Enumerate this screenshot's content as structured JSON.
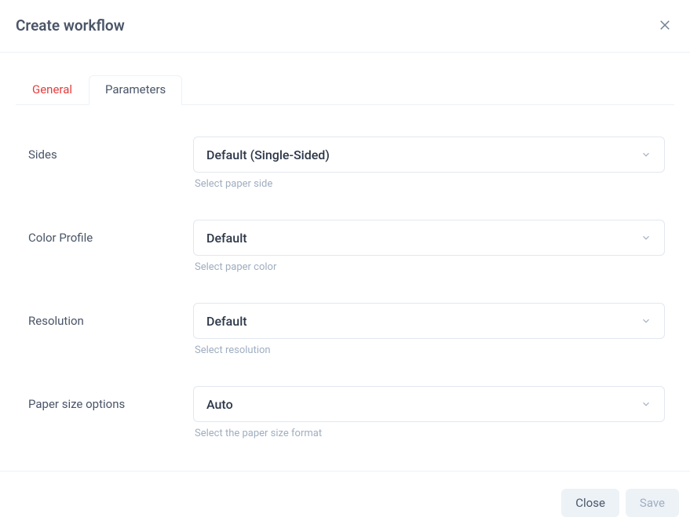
{
  "header": {
    "title": "Create workflow"
  },
  "tabs": {
    "general": "General",
    "parameters": "Parameters"
  },
  "fields": {
    "sides": {
      "label": "Sides",
      "value": "Default (Single-Sided)",
      "helper": "Select paper side"
    },
    "color_profile": {
      "label": "Color Profile",
      "value": "Default",
      "helper": "Select paper color"
    },
    "resolution": {
      "label": "Resolution",
      "value": "Default",
      "helper": "Select resolution"
    },
    "paper_size": {
      "label": "Paper size options",
      "value": "Auto",
      "helper": "Select the paper size format"
    }
  },
  "footer": {
    "close": "Close",
    "save": "Save"
  }
}
